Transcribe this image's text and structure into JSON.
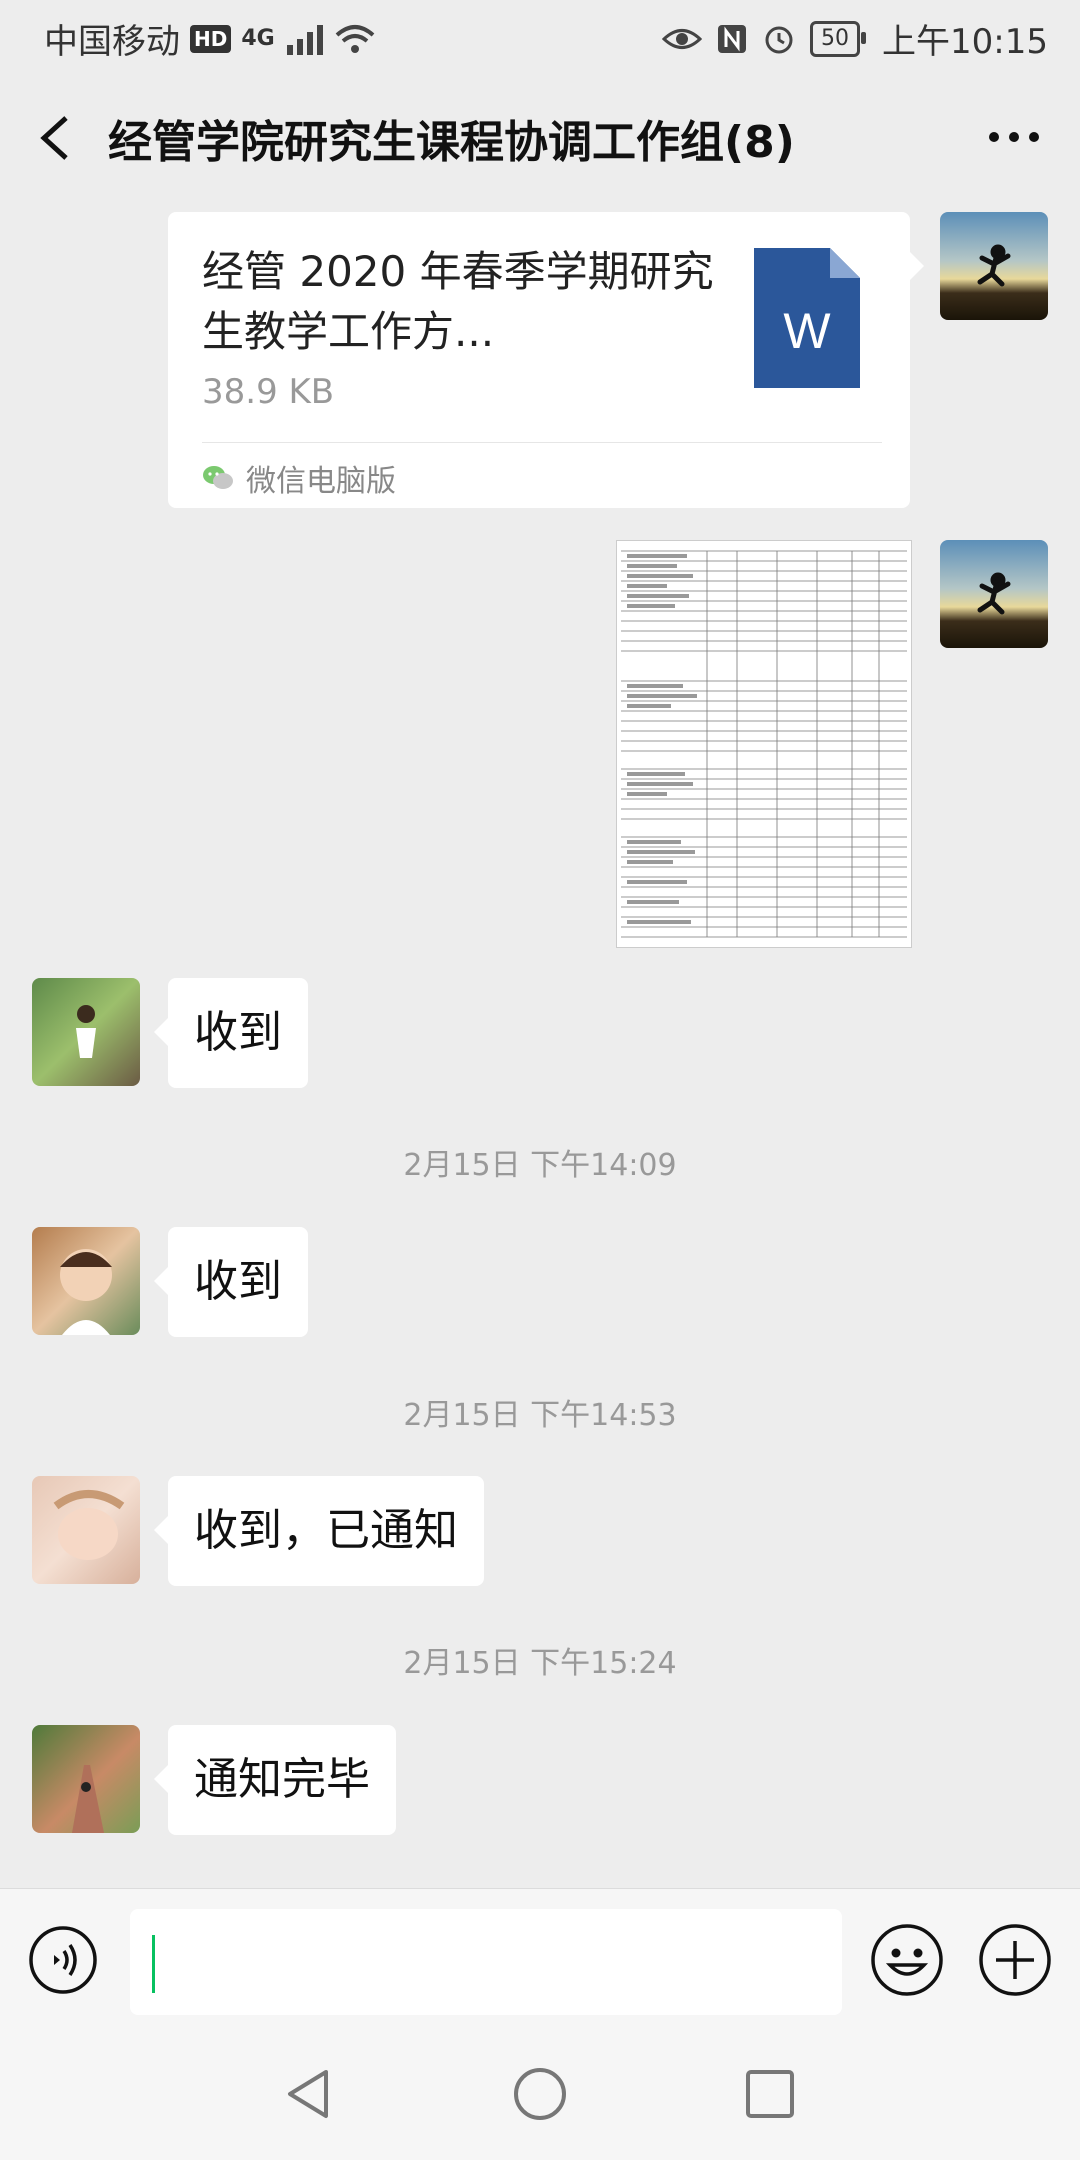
{
  "status_bar": {
    "carrier": "中国移动",
    "hd": "HD",
    "network": "4G",
    "battery": "50",
    "time": "上午10:15"
  },
  "header": {
    "title": "经管学院研究生课程协调工作组(8)"
  },
  "messages": {
    "file": {
      "name": "经管 2020 年春季学期研究生教学工作方...",
      "size": "38.9 KB",
      "source": "微信电脑版",
      "icon_letter": "W"
    },
    "msg1": "收到",
    "time1": "2月15日 下午14:09",
    "msg2": "收到",
    "time2": "2月15日 下午14:53",
    "msg3": "收到，已通知",
    "time3": "2月15日 下午15:24",
    "msg4": "通知完毕"
  },
  "colors": {
    "background": "#ededed",
    "bubble": "#ffffff",
    "word_blue": "#2b579a",
    "cursor": "#07c160"
  }
}
